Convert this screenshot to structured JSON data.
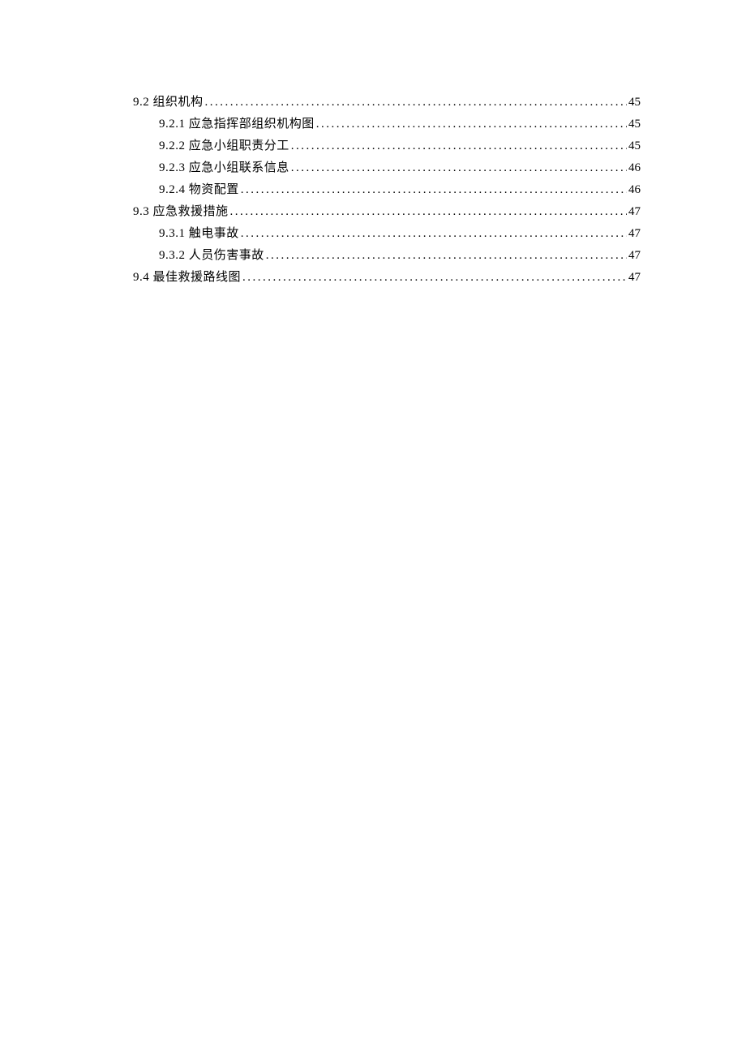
{
  "toc": [
    {
      "level": 1,
      "title": "9.2 组织机构",
      "page": "45"
    },
    {
      "level": 2,
      "title": "9.2.1 应急指挥部组织机构图",
      "page": "45"
    },
    {
      "level": 2,
      "title": "9.2.2 应急小组职责分工",
      "page": "45"
    },
    {
      "level": 2,
      "title": "9.2.3 应急小组联系信息",
      "page": "46"
    },
    {
      "level": 2,
      "title": "9.2.4 物资配置",
      "page": "46"
    },
    {
      "level": 1,
      "title": "9.3 应急救援措施",
      "page": "47"
    },
    {
      "level": 2,
      "title": "9.3.1 触电事故",
      "page": "47"
    },
    {
      "level": 2,
      "title": "9.3.2 人员伤害事故",
      "page": "47"
    },
    {
      "level": 1,
      "title": "9.4 最佳救援路线图",
      "page": "47"
    }
  ]
}
